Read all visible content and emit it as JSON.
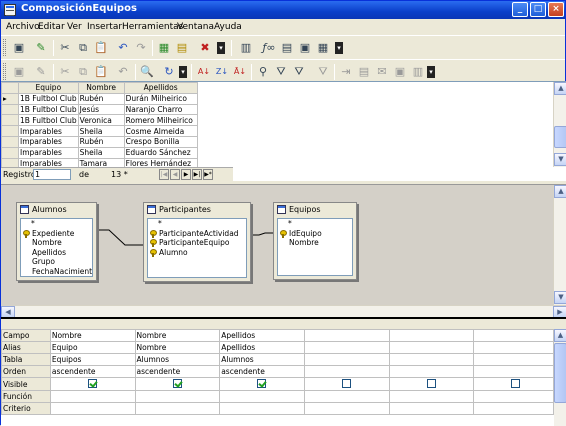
{
  "window": {
    "title": "ComposiciónEquipos"
  },
  "titlebar_buttons": [
    "_",
    "□",
    "×"
  ],
  "menu": [
    "Archivo",
    "Editar",
    "Ver",
    "Insertar",
    "Herramientas",
    "Ventana",
    "Ayuda"
  ],
  "toolbar1": [
    "save-icon",
    "edit-icon",
    "cut-icon",
    "copy-icon",
    "paste-icon",
    "undo-icon",
    "redo-icon",
    "design-view-icon",
    "sql-view-icon",
    "clear-query-icon",
    "add-table-icon",
    "functions-icon",
    "table-name-icon",
    "alias-icon",
    "distinct-icon"
  ],
  "toolbar2": [
    "save-record-icon",
    "edit-data-icon",
    "cut-icon",
    "copy-icon",
    "paste-icon",
    "undo-icon",
    "find-icon",
    "refresh-icon",
    "sort-ascending-icon",
    "sort-descending-icon",
    "autofilter-icon",
    "standard-filter-icon",
    "remove-filter-icon",
    "apply-filter-icon",
    "data-to-text-icon",
    "data-to-fields-icon",
    "mail-merge-icon",
    "explorer-icon"
  ],
  "data_grid": {
    "headers": [
      "Equipo",
      "Nombre",
      "Apellidos"
    ],
    "rows": [
      [
        "1B Fultbol Club",
        "Rubén",
        "Durán Milheirico"
      ],
      [
        "1B Fultbol Club",
        "Jesús",
        "Naranjo Charro"
      ],
      [
        "1B Fultbol Club",
        "Veronica",
        "Romero Milheirico"
      ],
      [
        "Imparables",
        "Sheila",
        "Cosme Almeida"
      ],
      [
        "Imparables",
        "Rubén",
        "Crespo Bonilla"
      ],
      [
        "Imparables",
        "Sheila",
        "Eduardo Sánchez"
      ],
      [
        "Imparables",
        "Tamara",
        "Flores Hernández"
      ]
    ]
  },
  "record_nav": {
    "label": "Registro",
    "current": "1",
    "of": "de",
    "total": "13 *"
  },
  "tables": {
    "alumnos": {
      "title": "Alumnos",
      "fields": [
        "*",
        "Expediente",
        "Nombre",
        "Apellidos",
        "Grupo",
        "FechaNacimiento"
      ],
      "keys": [
        "Expediente"
      ]
    },
    "participantes": {
      "title": "Participantes",
      "fields": [
        "*",
        "ParticipanteActividad",
        "ParticipanteEquipo",
        "Alumno"
      ],
      "keys": [
        "ParticipanteActividad",
        "ParticipanteEquipo",
        "Alumno"
      ]
    },
    "equipos": {
      "title": "Equipos",
      "fields": [
        "*",
        "IdEquipo",
        "Nombre"
      ],
      "keys": [
        "IdEquipo"
      ]
    }
  },
  "query_grid": {
    "row_labels": [
      "Campo",
      "Alias",
      "Tabla",
      "Orden",
      "Visible",
      "Función",
      "Criterio"
    ],
    "columns": [
      {
        "campo": "Nombre",
        "alias": "Equipo",
        "tabla": "Equipos",
        "orden": "ascendente",
        "visible": true
      },
      {
        "campo": "Nombre",
        "alias": "Nombre",
        "tabla": "Alumnos",
        "orden": "ascendente",
        "visible": true
      },
      {
        "campo": "Apellidos",
        "alias": "Apellidos",
        "tabla": "Alumnos",
        "orden": "ascendente",
        "visible": true
      },
      {
        "campo": "",
        "alias": "",
        "tabla": "",
        "orden": "",
        "visible": false
      },
      {
        "campo": "",
        "alias": "",
        "tabla": "",
        "orden": "",
        "visible": false
      },
      {
        "campo": "",
        "alias": "",
        "tabla": "",
        "orden": "",
        "visible": false
      }
    ]
  },
  "colors": {
    "titlebar": "#0a3fc9",
    "chrome": "#ece9d8",
    "design_bg": "#d4d0c8",
    "check": "#21a121"
  }
}
